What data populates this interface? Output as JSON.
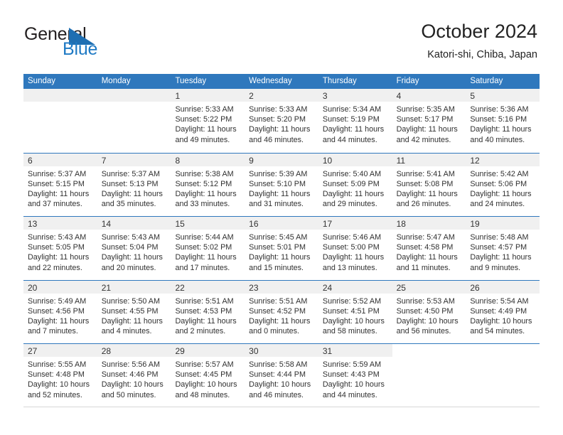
{
  "brand": {
    "name_part1": "General",
    "name_part2": "Blue",
    "flag_color": "#1f6fb2",
    "text_color": "#231f20",
    "blue_color": "#1f7ac4"
  },
  "header": {
    "title": "October 2024",
    "location": "Katori-shi, Chiba, Japan"
  },
  "theme": {
    "header_blue": "#2f78bd",
    "daynum_band": "#f0f0f0",
    "text": "#303030"
  },
  "weekday_headers": [
    "Sunday",
    "Monday",
    "Tuesday",
    "Wednesday",
    "Thursday",
    "Friday",
    "Saturday"
  ],
  "weeks": [
    [
      {
        "day": "",
        "lines": []
      },
      {
        "day": "",
        "lines": []
      },
      {
        "day": "1",
        "lines": [
          "Sunrise: 5:33 AM",
          "Sunset: 5:22 PM",
          "Daylight: 11 hours",
          "and 49 minutes."
        ]
      },
      {
        "day": "2",
        "lines": [
          "Sunrise: 5:33 AM",
          "Sunset: 5:20 PM",
          "Daylight: 11 hours",
          "and 46 minutes."
        ]
      },
      {
        "day": "3",
        "lines": [
          "Sunrise: 5:34 AM",
          "Sunset: 5:19 PM",
          "Daylight: 11 hours",
          "and 44 minutes."
        ]
      },
      {
        "day": "4",
        "lines": [
          "Sunrise: 5:35 AM",
          "Sunset: 5:17 PM",
          "Daylight: 11 hours",
          "and 42 minutes."
        ]
      },
      {
        "day": "5",
        "lines": [
          "Sunrise: 5:36 AM",
          "Sunset: 5:16 PM",
          "Daylight: 11 hours",
          "and 40 minutes."
        ]
      }
    ],
    [
      {
        "day": "6",
        "lines": [
          "Sunrise: 5:37 AM",
          "Sunset: 5:15 PM",
          "Daylight: 11 hours",
          "and 37 minutes."
        ]
      },
      {
        "day": "7",
        "lines": [
          "Sunrise: 5:37 AM",
          "Sunset: 5:13 PM",
          "Daylight: 11 hours",
          "and 35 minutes."
        ]
      },
      {
        "day": "8",
        "lines": [
          "Sunrise: 5:38 AM",
          "Sunset: 5:12 PM",
          "Daylight: 11 hours",
          "and 33 minutes."
        ]
      },
      {
        "day": "9",
        "lines": [
          "Sunrise: 5:39 AM",
          "Sunset: 5:10 PM",
          "Daylight: 11 hours",
          "and 31 minutes."
        ]
      },
      {
        "day": "10",
        "lines": [
          "Sunrise: 5:40 AM",
          "Sunset: 5:09 PM",
          "Daylight: 11 hours",
          "and 29 minutes."
        ]
      },
      {
        "day": "11",
        "lines": [
          "Sunrise: 5:41 AM",
          "Sunset: 5:08 PM",
          "Daylight: 11 hours",
          "and 26 minutes."
        ]
      },
      {
        "day": "12",
        "lines": [
          "Sunrise: 5:42 AM",
          "Sunset: 5:06 PM",
          "Daylight: 11 hours",
          "and 24 minutes."
        ]
      }
    ],
    [
      {
        "day": "13",
        "lines": [
          "Sunrise: 5:43 AM",
          "Sunset: 5:05 PM",
          "Daylight: 11 hours",
          "and 22 minutes."
        ]
      },
      {
        "day": "14",
        "lines": [
          "Sunrise: 5:43 AM",
          "Sunset: 5:04 PM",
          "Daylight: 11 hours",
          "and 20 minutes."
        ]
      },
      {
        "day": "15",
        "lines": [
          "Sunrise: 5:44 AM",
          "Sunset: 5:02 PM",
          "Daylight: 11 hours",
          "and 17 minutes."
        ]
      },
      {
        "day": "16",
        "lines": [
          "Sunrise: 5:45 AM",
          "Sunset: 5:01 PM",
          "Daylight: 11 hours",
          "and 15 minutes."
        ]
      },
      {
        "day": "17",
        "lines": [
          "Sunrise: 5:46 AM",
          "Sunset: 5:00 PM",
          "Daylight: 11 hours",
          "and 13 minutes."
        ]
      },
      {
        "day": "18",
        "lines": [
          "Sunrise: 5:47 AM",
          "Sunset: 4:58 PM",
          "Daylight: 11 hours",
          "and 11 minutes."
        ]
      },
      {
        "day": "19",
        "lines": [
          "Sunrise: 5:48 AM",
          "Sunset: 4:57 PM",
          "Daylight: 11 hours",
          "and 9 minutes."
        ]
      }
    ],
    [
      {
        "day": "20",
        "lines": [
          "Sunrise: 5:49 AM",
          "Sunset: 4:56 PM",
          "Daylight: 11 hours",
          "and 7 minutes."
        ]
      },
      {
        "day": "21",
        "lines": [
          "Sunrise: 5:50 AM",
          "Sunset: 4:55 PM",
          "Daylight: 11 hours",
          "and 4 minutes."
        ]
      },
      {
        "day": "22",
        "lines": [
          "Sunrise: 5:51 AM",
          "Sunset: 4:53 PM",
          "Daylight: 11 hours",
          "and 2 minutes."
        ]
      },
      {
        "day": "23",
        "lines": [
          "Sunrise: 5:51 AM",
          "Sunset: 4:52 PM",
          "Daylight: 11 hours",
          "and 0 minutes."
        ]
      },
      {
        "day": "24",
        "lines": [
          "Sunrise: 5:52 AM",
          "Sunset: 4:51 PM",
          "Daylight: 10 hours",
          "and 58 minutes."
        ]
      },
      {
        "day": "25",
        "lines": [
          "Sunrise: 5:53 AM",
          "Sunset: 4:50 PM",
          "Daylight: 10 hours",
          "and 56 minutes."
        ]
      },
      {
        "day": "26",
        "lines": [
          "Sunrise: 5:54 AM",
          "Sunset: 4:49 PM",
          "Daylight: 10 hours",
          "and 54 minutes."
        ]
      }
    ],
    [
      {
        "day": "27",
        "lines": [
          "Sunrise: 5:55 AM",
          "Sunset: 4:48 PM",
          "Daylight: 10 hours",
          "and 52 minutes."
        ]
      },
      {
        "day": "28",
        "lines": [
          "Sunrise: 5:56 AM",
          "Sunset: 4:46 PM",
          "Daylight: 10 hours",
          "and 50 minutes."
        ]
      },
      {
        "day": "29",
        "lines": [
          "Sunrise: 5:57 AM",
          "Sunset: 4:45 PM",
          "Daylight: 10 hours",
          "and 48 minutes."
        ]
      },
      {
        "day": "30",
        "lines": [
          "Sunrise: 5:58 AM",
          "Sunset: 4:44 PM",
          "Daylight: 10 hours",
          "and 46 minutes."
        ]
      },
      {
        "day": "31",
        "lines": [
          "Sunrise: 5:59 AM",
          "Sunset: 4:43 PM",
          "Daylight: 10 hours",
          "and 44 minutes."
        ]
      },
      {
        "day": "",
        "lines": []
      },
      {
        "day": "",
        "lines": []
      }
    ]
  ]
}
